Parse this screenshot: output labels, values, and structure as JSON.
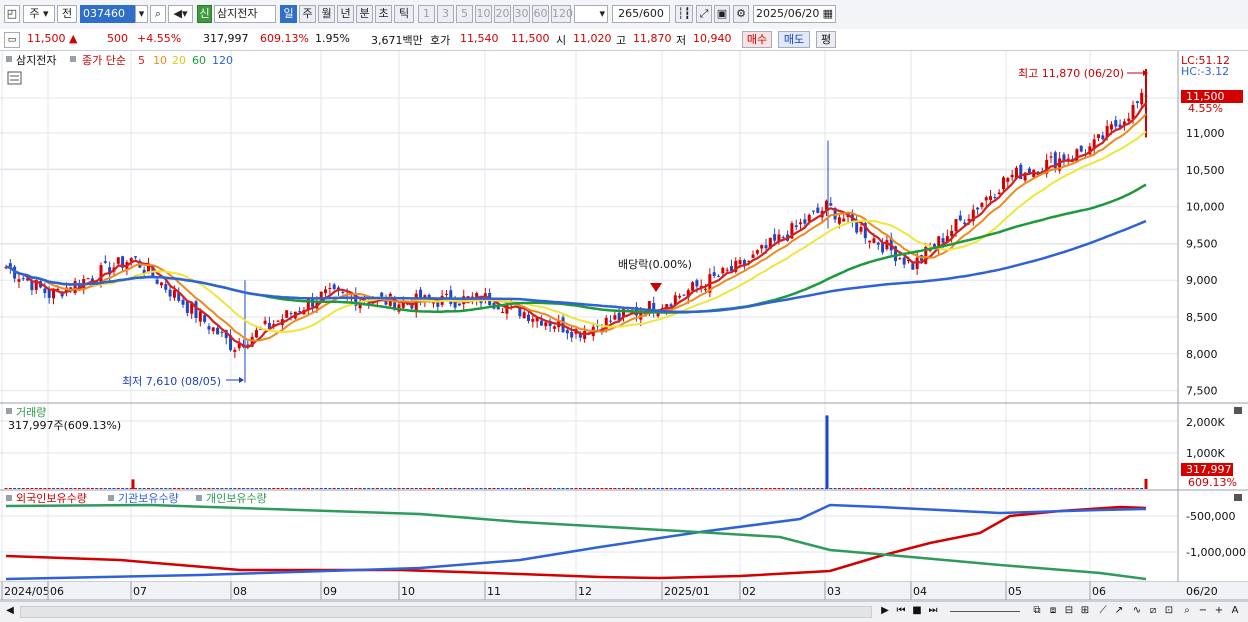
{
  "toolbar": {
    "market": "주",
    "mode": "전",
    "code": "037460",
    "badge": "신",
    "stock_name": "삼지전자",
    "periods": [
      "일",
      "주",
      "월",
      "년",
      "분",
      "초",
      "틱"
    ],
    "selected_period": "일",
    "intervals": [
      "1",
      "3",
      "5",
      "10",
      "20",
      "30",
      "60",
      "120"
    ],
    "count": "265",
    "count_max": "/600",
    "date": "2025/06/20"
  },
  "quote": {
    "price": "11,500",
    "arrow": "▲",
    "change": "500",
    "change_pct": "+4.55%",
    "volume": "317,997",
    "volume_ratio": "609.13%",
    "turnover": "1.95%",
    "value": "3,671백만",
    "bid_label": "호가",
    "bid1": "11,540",
    "bid2": "11,500",
    "open_label": "시",
    "open": "11,020",
    "high_label": "고",
    "high": "11,870",
    "low_label": "저",
    "low": "10,940",
    "buy": "매수",
    "sell": "매도",
    "avg": "평"
  },
  "price_panel": {
    "name": "삼지전자",
    "legend_prefix": "종가 단순",
    "ma_labels": [
      "5",
      "10",
      "20",
      "60",
      "120"
    ],
    "lc": "LC:51.12",
    "hc": "HC:-3.12",
    "high_note": "최고 11,870 (06/20)",
    "low_note": "최저 7,610 (08/05)",
    "dividend_note": "배당락(0.00%)",
    "last_price_tag": "11,500",
    "last_pct": "4.55%",
    "y_ticks": [
      "11,000",
      "10,500",
      "10,000",
      "9,500",
      "9,000",
      "8,500",
      "8,000",
      "7,500"
    ]
  },
  "volume_panel": {
    "title": "거래량",
    "summary": "317,997주(609.13%)",
    "y_ticks": [
      "2,000K",
      "1,000K"
    ],
    "last_tag": "317,997",
    "last_pct": "609.13%"
  },
  "holding_panel": {
    "legend": [
      "외국인보유수량",
      "기관보유수량",
      "개인보유수량"
    ],
    "y_ticks": [
      "-500,000",
      "-1,000,000"
    ]
  },
  "x_labels": [
    "2024/05",
    "06",
    "07",
    "08",
    "09",
    "10",
    "11",
    "12",
    "2025/01",
    "02",
    "03",
    "04",
    "05",
    "06",
    "06/20"
  ],
  "colors": {
    "ma5": "#d51f1f",
    "ma10": "#ef8a1a",
    "ma20": "#f0e63a",
    "ma60": "#1d9a3a",
    "ma120": "#2f62d8",
    "up": "#d40000",
    "down": "#1f46c8",
    "foreign": "#d40000",
    "institution": "#2f62d8",
    "individual": "#2e9a5c"
  },
  "chart_data": {
    "type": "candlestick",
    "title": "삼지전자",
    "x": [
      "2024/05",
      "06",
      "07",
      "08",
      "09",
      "10",
      "11",
      "12",
      "2025/01",
      "02",
      "03",
      "04",
      "05",
      "06",
      "06/20"
    ],
    "close": [
      9200,
      8800,
      9300,
      8100,
      8800,
      8700,
      8750,
      8300,
      8700,
      9200,
      10000,
      9200,
      10400,
      10800,
      11500
    ],
    "volume": [
      20000,
      15000,
      300000,
      30000,
      20000,
      15000,
      20000,
      30000,
      20000,
      40000,
      2300000,
      60000,
      80000,
      60000,
      317997
    ],
    "high": 11870,
    "low": 7610,
    "ylim": [
      7300,
      12000
    ]
  }
}
